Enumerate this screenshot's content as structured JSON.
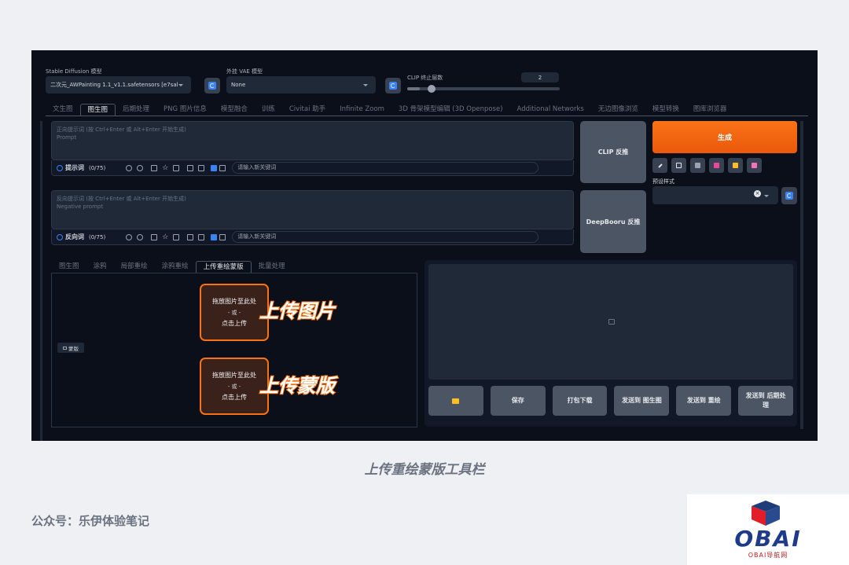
{
  "models": {
    "sd_label": "Stable Diffusion 模型",
    "sd_value": "二次元_AWPainting 1.1_v1.1.safetensors [e7sal",
    "vae_label": "外挂 VAE 模型",
    "vae_value": "None",
    "clip_label": "CLIP 终止层数",
    "clip_value": "2",
    "clip_fraction": 0.08
  },
  "main_tabs": [
    "文生图",
    "图生图",
    "后期处理",
    "PNG 图片信息",
    "模型融合",
    "训练",
    "Civitai 助手",
    "Infinite Zoom",
    "3D 骨架模型编辑 (3D Openpose)",
    "Additional Networks",
    "无边图像浏览",
    "模型转换",
    "图库浏览器"
  ],
  "positive": {
    "placeholder_1": "正向提示词 (按 Ctrl+Enter 或 Alt+Enter 开始生成)",
    "placeholder_2": "Prompt",
    "label": "提示词",
    "count": "(0/75)",
    "keyword_placeholder": "请输入新关键词"
  },
  "negative": {
    "placeholder_1": "反向提示词 (按 Ctrl+Enter 或 Alt+Enter 开始生成)",
    "placeholder_2": "Negative prompt",
    "label": "反向词",
    "count": "(0/75)",
    "keyword_placeholder": "请输入新关键词"
  },
  "buttons": {
    "clip": "CLIP 反推",
    "deepbooru": "DeepBooru 反推",
    "generate": "生成",
    "preset_label": "预设样式"
  },
  "sub_tabs": [
    "图生图",
    "涂鸦",
    "局部重绘",
    "涂鸦重绘",
    "上传重绘蒙版",
    "批量处理"
  ],
  "upload": {
    "drop_line": "拖放图片至此处",
    "or": "- 或 -",
    "click": "点击上传",
    "mask_tag": "蒙版",
    "callout_image": "上传图片",
    "callout_mask": "上传蒙版"
  },
  "output_buttons": [
    "保存",
    "打包下载",
    "发送到 图生图",
    "发送到 重绘",
    "发送到 后期处理"
  ],
  "caption": "上传重绘蒙版工具栏",
  "footer": "公众号：乐伊体验笔记",
  "logo": {
    "text": "OBAI",
    "sub": "OBAI导航网"
  },
  "colors": {
    "accent": "#f97316",
    "app_bg": "#0b0f19",
    "panel": "#1f2937"
  }
}
